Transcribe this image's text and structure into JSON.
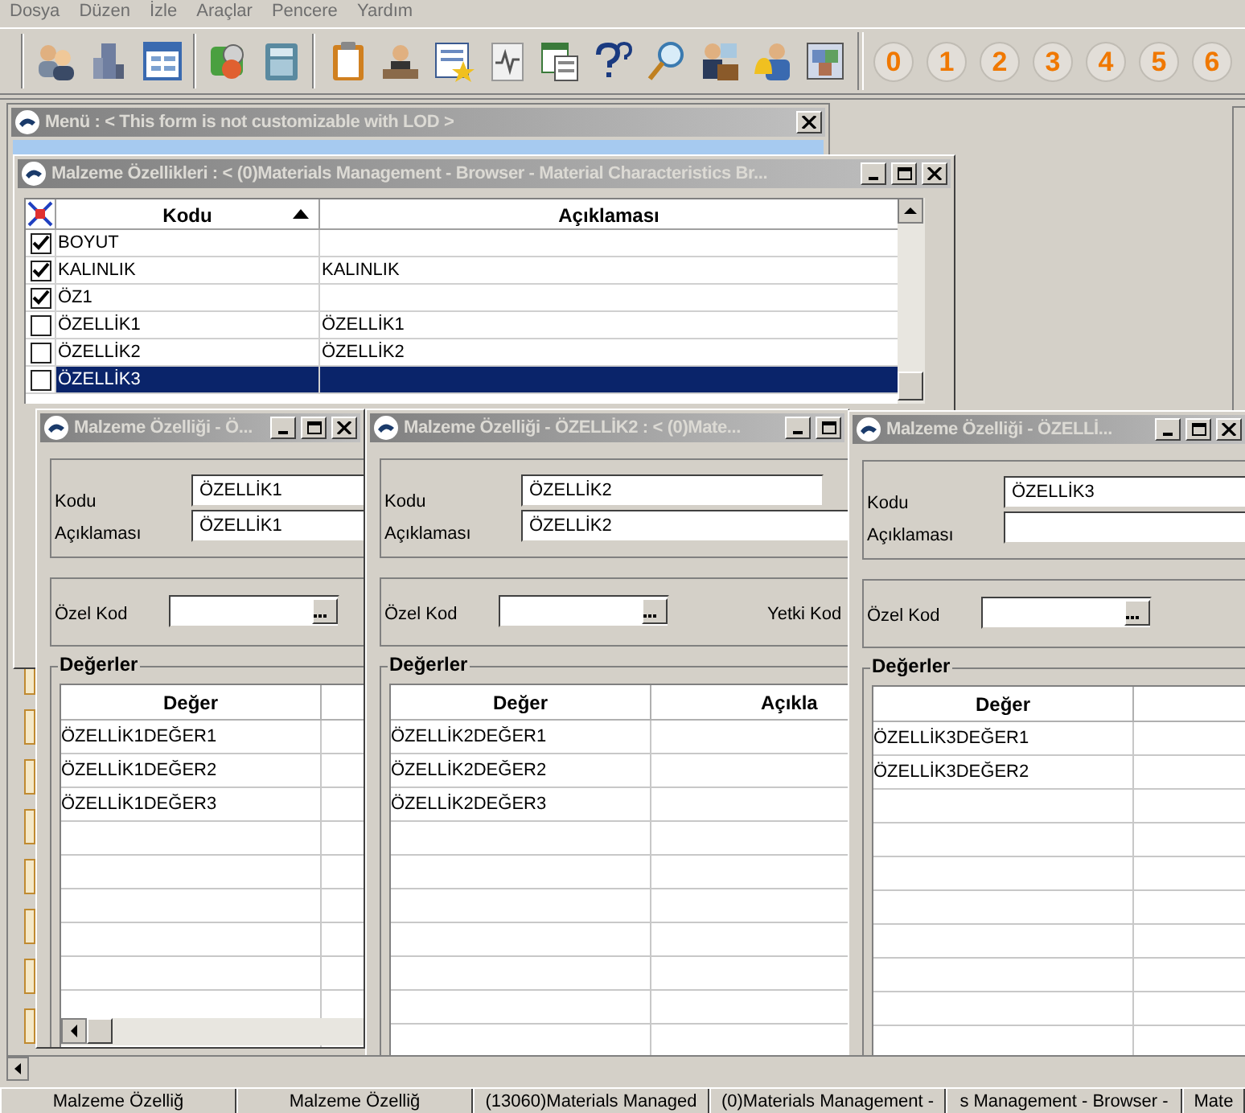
{
  "menu_bar": [
    "Dosya",
    "Düzen",
    "İzle",
    "Araçlar",
    "Pencere",
    "Yardım"
  ],
  "toolbar": {
    "number_buttons": [
      "0",
      "1",
      "2",
      "3",
      "4",
      "5",
      "6"
    ]
  },
  "menu_window": {
    "title": "Menü : < This form is not customizable with LOD >"
  },
  "browser_window": {
    "title": "Malzeme Özellikleri : < (0)Materials Management - Browser - Material Characteristics Br...",
    "columns": [
      "Kodu",
      "Açıklaması"
    ],
    "rows": [
      {
        "code": "BOYUT",
        "description": "",
        "checked": true,
        "selected": false
      },
      {
        "code": "KALINLIK",
        "description": "KALINLIK",
        "checked": true,
        "selected": false
      },
      {
        "code": "ÖZ1",
        "description": "",
        "checked": true,
        "selected": false
      },
      {
        "code": "ÖZELLİK1",
        "description": "ÖZELLİK1",
        "checked": false,
        "selected": false
      },
      {
        "code": "ÖZELLİK2",
        "description": "ÖZELLİK2",
        "checked": false,
        "selected": false
      },
      {
        "code": "ÖZELLİK3",
        "description": "",
        "checked": false,
        "selected": true
      }
    ]
  },
  "detail_windows": [
    {
      "title": "Malzeme Özelliği - Ö...",
      "code_label": "Kodu",
      "code": "ÖZELLİK1",
      "description_label": "Açıklaması",
      "description": "ÖZELLİK1",
      "special_code_label": "Özel Kod",
      "values_title": "Değerler",
      "value_columns": [
        "Değer"
      ],
      "values": [
        "ÖZELLİK1DEĞER1",
        "ÖZELLİK1DEĞER2",
        "ÖZELLİK1DEĞER3"
      ]
    },
    {
      "title": "Malzeme Özelliği - ÖZELLİK2 : < (0)Mate...",
      "code_label": "Kodu",
      "code": "ÖZELLİK2",
      "description_label": "Açıklaması",
      "description": "ÖZELLİK2",
      "special_code_label": "Özel Kod",
      "auth_code_label": "Yetki Kod",
      "values_title": "Değerler",
      "value_columns": [
        "Değer",
        "Açıkla"
      ],
      "values": [
        "ÖZELLİK2DEĞER1",
        "ÖZELLİK2DEĞER2",
        "ÖZELLİK2DEĞER3"
      ]
    },
    {
      "title": "Malzeme Özelliği - ÖZELLİ...",
      "code_label": "Kodu",
      "code": "ÖZELLİK3",
      "description_label": "Açıklaması",
      "special_code_label": "Özel Kod",
      "values_title": "Değerler",
      "value_columns": [
        "Değer"
      ],
      "values": [
        "ÖZELLİK3DEĞER1",
        "ÖZELLİK3DEĞER2"
      ]
    }
  ],
  "taskbar": [
    "Malzeme Özelliğ",
    "Malzeme Özelliğ",
    "(13060)Materials Managed",
    "(0)Materials Management -",
    "s Management - Browser -",
    "Mate"
  ]
}
